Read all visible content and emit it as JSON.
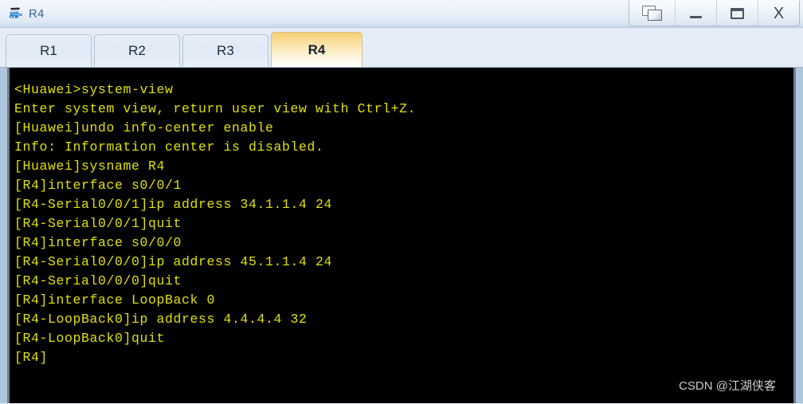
{
  "window": {
    "title": "R4",
    "icon": "router-icon",
    "controls": [
      {
        "name": "restore-button",
        "icon": "restore-icon",
        "label": ""
      },
      {
        "name": "minimize-button",
        "icon": "minimize-icon",
        "label": ""
      },
      {
        "name": "maximize-button",
        "icon": "maximize-icon",
        "label": ""
      },
      {
        "name": "close-button",
        "icon": "close-icon",
        "label": "X"
      }
    ]
  },
  "tabs": [
    {
      "label": "R1",
      "active": false
    },
    {
      "label": "R2",
      "active": false
    },
    {
      "label": "R3",
      "active": false
    },
    {
      "label": "R4",
      "active": true
    }
  ],
  "terminal": {
    "text_color": "#e0e000",
    "background_color": "#000000",
    "lines": [
      "<Huawei>system-view",
      "Enter system view, return user view with Ctrl+Z.",
      "[Huawei]undo info-center enable",
      "Info: Information center is disabled.",
      "[Huawei]sysname R4",
      "[R4]interface s0/0/1",
      "[R4-Serial0/0/1]ip address 34.1.1.4 24",
      "[R4-Serial0/0/1]quit",
      "[R4]interface s0/0/0",
      "[R4-Serial0/0/0]ip address 45.1.1.4 24",
      "[R4-Serial0/0/0]quit",
      "[R4]interface LoopBack 0",
      "[R4-LoopBack0]ip address 4.4.4.4 32",
      "[R4-LoopBack0]quit",
      "[R4]"
    ]
  },
  "watermark": {
    "text": "CSDN @江湖侠客"
  }
}
